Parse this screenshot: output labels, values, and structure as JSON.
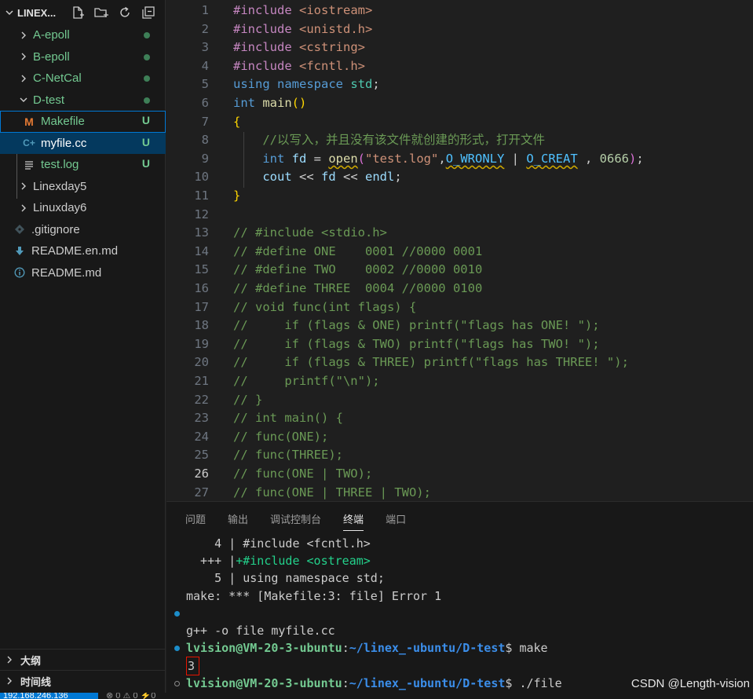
{
  "explorer": {
    "title": "LINEX...",
    "actions": [
      "new-file-icon",
      "new-folder-icon",
      "refresh-icon",
      "collapse-all-icon"
    ],
    "items": [
      {
        "label": "A-epoll",
        "type": "folder",
        "status": "dot"
      },
      {
        "label": "B-epoll",
        "type": "folder",
        "status": "dot"
      },
      {
        "label": "C-NetCal",
        "type": "folder",
        "status": "dot"
      },
      {
        "label": "D-test",
        "type": "folder-open",
        "status": "dot"
      },
      {
        "label": "Makefile",
        "type": "file",
        "icon": "M",
        "status": "U"
      },
      {
        "label": "myfile.cc",
        "type": "file",
        "icon": "C+",
        "status": "U"
      },
      {
        "label": "test.log",
        "type": "file",
        "status": "U"
      },
      {
        "label": "Linexday5",
        "type": "folder"
      },
      {
        "label": "Linuxday6",
        "type": "folder"
      },
      {
        "label": ".gitignore",
        "type": "file"
      },
      {
        "label": "README.en.md",
        "type": "file"
      },
      {
        "label": "README.md",
        "type": "file"
      }
    ],
    "outline_label": "大纲",
    "timeline_label": "时间线"
  },
  "editor": {
    "active_line": 26,
    "line_numbers": [
      "1",
      "2",
      "3",
      "4",
      "5",
      "6",
      "7",
      "8",
      "9",
      "10",
      "11",
      "12",
      "13",
      "14",
      "15",
      "16",
      "17",
      "18",
      "19",
      "20",
      "21",
      "22",
      "23",
      "24",
      "25",
      "26",
      "27"
    ],
    "code": {
      "l1_kw": "#include",
      "l1_str": "<iostream>",
      "l2_kw": "#include",
      "l2_str": "<unistd.h>",
      "l3_kw": "#include",
      "l3_str": "<cstring>",
      "l4_kw": "#include",
      "l4_str": "<fcntl.h>",
      "l5_a": "using",
      "l5_b": "namespace",
      "l5_c": "std",
      "l6_a": "int",
      "l6_b": "main",
      "l8": "//以写入，并且没有该文件就创建的形式，打开文件",
      "l9_int": "int",
      "l9_fd": "fd",
      "l9_open": "open",
      "l9_str": "\"test.log\"",
      "l9_m1": "O_WRONLY",
      "l9_m2": "O_CREAT",
      "l9_num": "0666",
      "l10_cout": "cout",
      "l10_fd": "fd",
      "l10_endl": "endl",
      "l13": "// #include <stdio.h>",
      "l14": "// #define ONE    0001 //0000 0001",
      "l15": "// #define TWO    0002 //0000 0010",
      "l16": "// #define THREE  0004 //0000 0100",
      "l17": "// void func(int flags) {",
      "l18": "//     if (flags & ONE) printf(\"flags has ONE! \");",
      "l19": "//     if (flags & TWO) printf(\"flags has TWO! \");",
      "l20": "//     if (flags & THREE) printf(\"flags has THREE! \");",
      "l21": "//     printf(\"\\n\");",
      "l22": "// }",
      "l23": "// int main() {",
      "l24": "// func(ONE);",
      "l25": "// func(THREE);",
      "l26": "// func(ONE | TWO);",
      "l27": "// func(ONE | THREE | TWO);"
    }
  },
  "panel": {
    "tabs": [
      "问题",
      "输出",
      "调试控制台",
      "终端",
      "端口"
    ],
    "active_tab": "终端",
    "terminal": {
      "t1": "    4 | #include <fcntl.h>",
      "t2_a": "  +++ |",
      "t2_b": "+#include <ostream>",
      "t3": "    5 | using namespace std;",
      "t4": "make: *** [Makefile:3: file] Error 1",
      "prompt_user": "lvision@VM-20-3-ubuntu",
      "prompt_path": "~/linex_-ubuntu/D-test",
      "cmd1": "make",
      "t6": "g++ -o file myfile.cc",
      "cmd2": "./file",
      "output": "3"
    }
  },
  "watermark": "CSDN @Length-vision",
  "statusbar": {
    "remote": "192.168.246.136",
    "items": "⊗ 0 ⚠ 0  ⚡0"
  }
}
